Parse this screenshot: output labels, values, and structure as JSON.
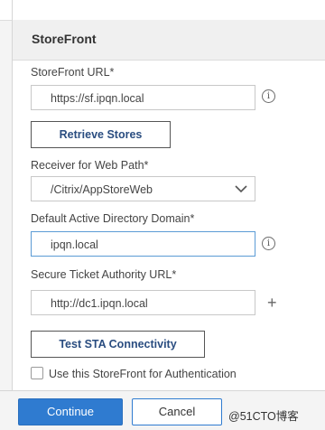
{
  "panel": {
    "title": "StoreFront"
  },
  "storefront_url": {
    "label": "StoreFront URL*",
    "value": "https://sf.ipqn.local",
    "info_icon": "info-icon"
  },
  "retrieve_button": {
    "label": "Retrieve Stores"
  },
  "receiver_path": {
    "label": "Receiver for Web Path*",
    "selected": "/Citrix/AppStoreWeb",
    "icon": "chevron-down-icon"
  },
  "ad_domain": {
    "label": "Default Active Directory Domain*",
    "value": "ipqn.local",
    "info_icon": "info-icon"
  },
  "sta_url": {
    "label": "Secure Ticket Authority URL*",
    "value": "http://dc1.ipqn.local",
    "add_icon": "plus-icon"
  },
  "sta_button": {
    "label": "Test STA Connectivity"
  },
  "auth_checkbox": {
    "label": "Use this StoreFront for Authentication",
    "checked": false
  },
  "footer": {
    "continue_label": "Continue",
    "cancel_label": "Cancel"
  },
  "watermark": {
    "text": "@51CTO博客"
  },
  "colors": {
    "accent": "#2f7bd0",
    "focus_border": "#5b9bd5"
  }
}
